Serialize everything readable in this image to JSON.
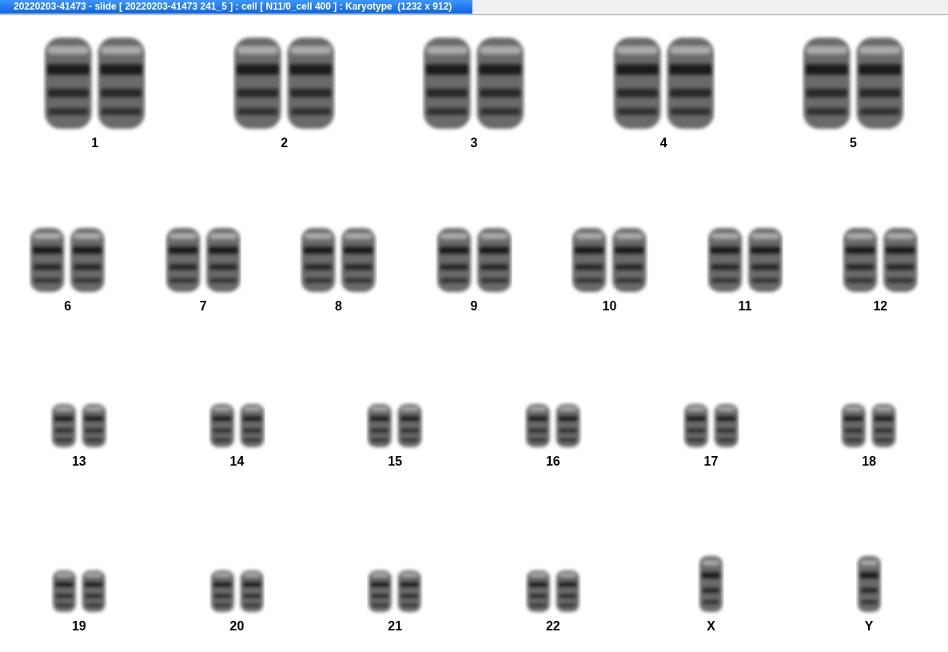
{
  "window": {
    "title": "20220203-41473 - slide [ 20220203-41473 241_5 ] : cell [ N11/0_cell 400 ] : Karyotype  (1232 x 912)"
  },
  "rows": [
    {
      "items": [
        {
          "label": "1",
          "kind": "pair"
        },
        {
          "label": "2",
          "kind": "pair"
        },
        {
          "label": "3",
          "kind": "pair"
        },
        {
          "label": "4",
          "kind": "pair"
        },
        {
          "label": "5",
          "kind": "pair"
        }
      ]
    },
    {
      "items": [
        {
          "label": "6",
          "kind": "pair"
        },
        {
          "label": "7",
          "kind": "pair"
        },
        {
          "label": "8",
          "kind": "pair"
        },
        {
          "label": "9",
          "kind": "pair"
        },
        {
          "label": "10",
          "kind": "pair"
        },
        {
          "label": "11",
          "kind": "pair"
        },
        {
          "label": "12",
          "kind": "pair"
        }
      ]
    },
    {
      "items": [
        {
          "label": "13",
          "kind": "pair"
        },
        {
          "label": "14",
          "kind": "pair"
        },
        {
          "label": "15",
          "kind": "pair"
        },
        {
          "label": "16",
          "kind": "pair"
        },
        {
          "label": "17",
          "kind": "pair"
        },
        {
          "label": "18",
          "kind": "pair"
        }
      ]
    },
    {
      "items": [
        {
          "label": "19",
          "kind": "pair"
        },
        {
          "label": "20",
          "kind": "pair"
        },
        {
          "label": "21",
          "kind": "pair"
        },
        {
          "label": "22",
          "kind": "pair"
        },
        {
          "label": "X",
          "kind": "single"
        },
        {
          "label": "Y",
          "kind": "single"
        }
      ]
    }
  ]
}
